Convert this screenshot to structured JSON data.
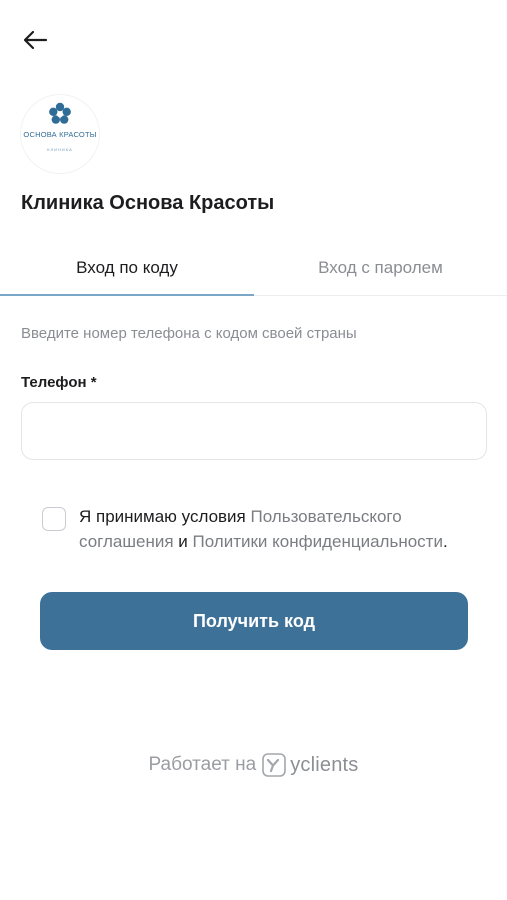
{
  "logo": {
    "name": "ОСНОВА КРАСОТЫ",
    "subtitle": "КЛИНИКА",
    "brand_color": "#2f6c96"
  },
  "header": {
    "back_icon": "arrow-left-icon",
    "title": "Клиника Основа Красоты"
  },
  "tabs": [
    {
      "label": "Вход по коду",
      "active": true
    },
    {
      "label": "Вход с паролем",
      "active": false
    }
  ],
  "form": {
    "hint": "Введите номер телефона с кодом своей страны",
    "phone_label": "Телефон *",
    "phone_value": "",
    "phone_placeholder": "",
    "consent": {
      "checked": false,
      "text_1": "Я принимаю условия ",
      "link_1": "Пользовательского соглашения",
      "text_2": " и ",
      "link_2": "Политики конфиденциальности",
      "text_3": "."
    },
    "submit_label": "Получить код"
  },
  "footer": {
    "powered_by": "Работает на",
    "brand": "yclients",
    "brand_icon": "yclients-logo-icon"
  },
  "colors": {
    "accent": "#3e7198",
    "tab_underline": "#7aa7c7",
    "muted_text": "#8a8d93"
  }
}
